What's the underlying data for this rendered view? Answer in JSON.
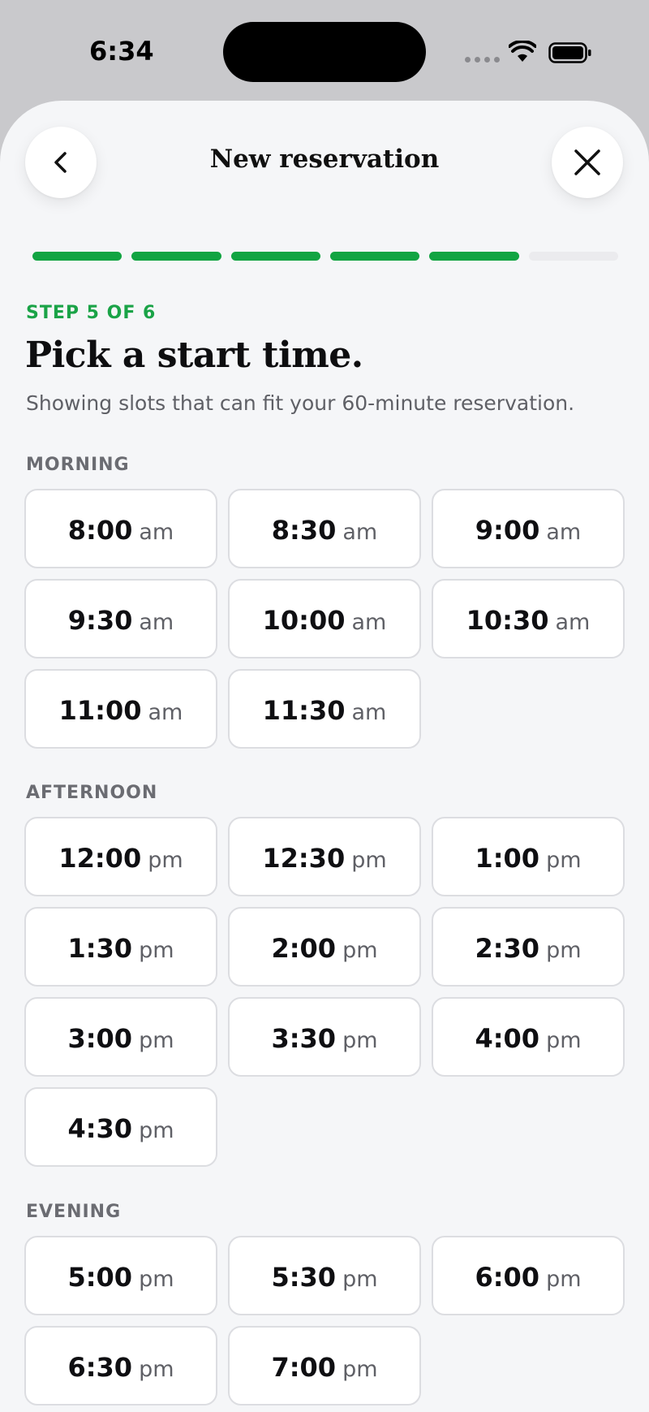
{
  "status_bar": {
    "time": "6:34"
  },
  "header": {
    "title": "New reservation",
    "back_icon": "chevron-left-icon",
    "close_icon": "close-icon"
  },
  "progress": {
    "total_steps": 6,
    "completed_steps": 5
  },
  "step": {
    "label": "STEP 5 OF 6",
    "title": "Pick a start time.",
    "subtitle": "Showing slots that can fit your 60-minute reservation."
  },
  "colors": {
    "accent": "#12a442",
    "background": "#f5f6f8",
    "card": "#ffffff"
  },
  "sections": [
    {
      "label": "MORNING",
      "slots": [
        {
          "time": "8:00",
          "meridiem": "am"
        },
        {
          "time": "8:30",
          "meridiem": "am"
        },
        {
          "time": "9:00",
          "meridiem": "am"
        },
        {
          "time": "9:30",
          "meridiem": "am"
        },
        {
          "time": "10:00",
          "meridiem": "am"
        },
        {
          "time": "10:30",
          "meridiem": "am"
        },
        {
          "time": "11:00",
          "meridiem": "am"
        },
        {
          "time": "11:30",
          "meridiem": "am"
        }
      ]
    },
    {
      "label": "AFTERNOON",
      "slots": [
        {
          "time": "12:00",
          "meridiem": "pm"
        },
        {
          "time": "12:30",
          "meridiem": "pm"
        },
        {
          "time": "1:00",
          "meridiem": "pm"
        },
        {
          "time": "1:30",
          "meridiem": "pm"
        },
        {
          "time": "2:00",
          "meridiem": "pm"
        },
        {
          "time": "2:30",
          "meridiem": "pm"
        },
        {
          "time": "3:00",
          "meridiem": "pm"
        },
        {
          "time": "3:30",
          "meridiem": "pm"
        },
        {
          "time": "4:00",
          "meridiem": "pm"
        },
        {
          "time": "4:30",
          "meridiem": "pm"
        }
      ]
    },
    {
      "label": "EVENING",
      "slots": [
        {
          "time": "5:00",
          "meridiem": "pm"
        },
        {
          "time": "5:30",
          "meridiem": "pm"
        },
        {
          "time": "6:00",
          "meridiem": "pm"
        },
        {
          "time": "6:30",
          "meridiem": "pm"
        },
        {
          "time": "7:00",
          "meridiem": "pm"
        }
      ]
    }
  ]
}
